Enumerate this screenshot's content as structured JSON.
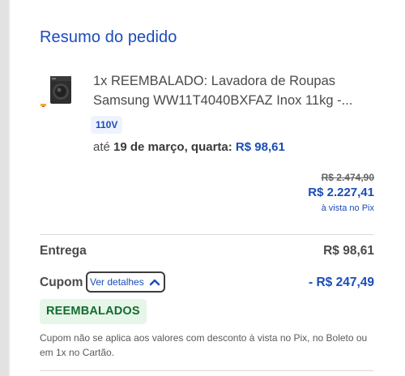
{
  "summary": {
    "title": "Resumo do pedido"
  },
  "item": {
    "name": "1x REEMBALADO: Lavadora de Roupas Samsung WW11T4040BXFAZ Inox 11kg -...",
    "voltage": "110V",
    "delivery_prefix": "até",
    "delivery_date": "19 de março, quarta:",
    "delivery_price": "R$ 98,61",
    "old_price": "R$ 2.474,90",
    "new_price": "R$ 2.227,41",
    "pix_note": "à vista no Pix",
    "thumbnail_icon": "washing-machine-icon"
  },
  "totals": {
    "shipping_label": "Entrega",
    "shipping_value": "R$ 98,61",
    "coupon_label": "Cupom",
    "details_label": "Ver detalhes",
    "coupon_discount": "- R$ 247,49",
    "coupon_code": "REEMBALADOS",
    "disclaimer": "Cupom não se aplica aos valores com desconto à vista no Pix, no Boleto ou em 1x no Cartão."
  },
  "colors": {
    "accent": "#1a4cb8",
    "coupon_bg": "#e6f6e9",
    "coupon_text": "#156b2f"
  }
}
